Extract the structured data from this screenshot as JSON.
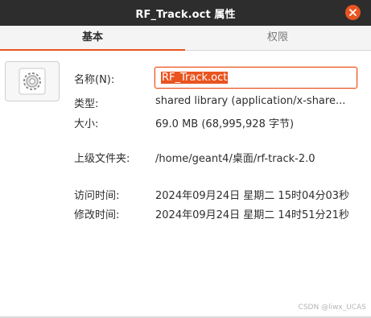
{
  "window": {
    "title": "RF_Track.oct 属性",
    "close_icon": "close-icon"
  },
  "tabs": [
    {
      "label": "基本",
      "active": true
    },
    {
      "label": "权限",
      "active": false
    }
  ],
  "file_icon": "shared-library-gear-icon",
  "properties": {
    "name": {
      "label": "名称(N):",
      "value": "RF_Track.oct"
    },
    "type": {
      "label": "类型:",
      "value": "shared library (application/x-share..."
    },
    "size": {
      "label": "大小:",
      "value": "69.0 MB (68,995,928 字节)"
    },
    "parent": {
      "label": "上级文件夹:",
      "value": "/home/geant4/桌面/rf-track-2.0"
    },
    "accessed": {
      "label": "访问时间:",
      "value": "2024年09月24日 星期二 15时04分03秒"
    },
    "modified": {
      "label": "修改时间:",
      "value": "2024年09月24日 星期二 14时51分21秒"
    }
  },
  "watermark": "CSDN @liwx_UCAS",
  "colors": {
    "accent": "#e95420",
    "titlebar": "#2d2d2d"
  }
}
